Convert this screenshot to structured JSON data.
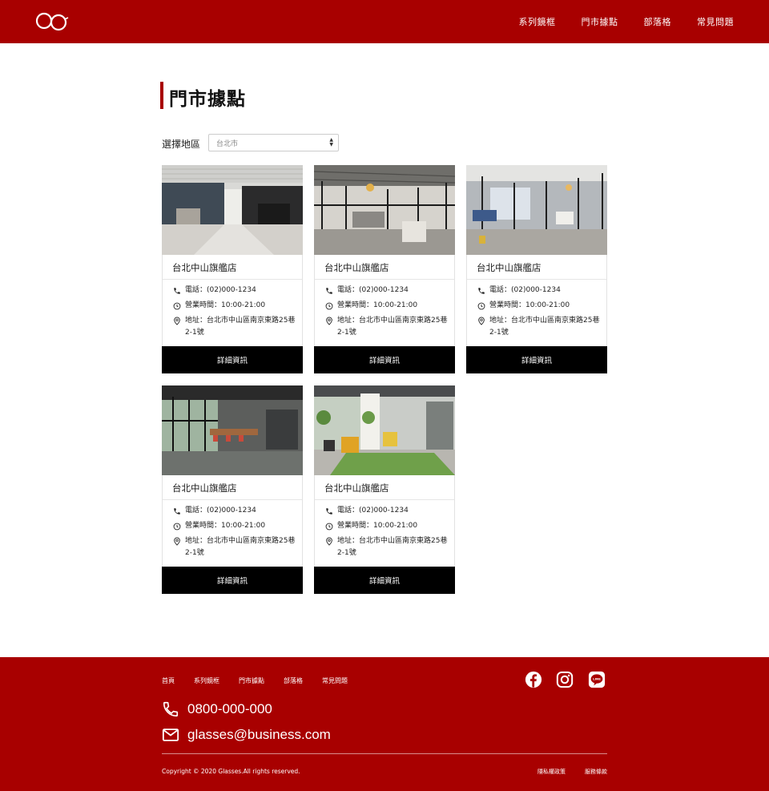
{
  "header": {
    "logo": "glasses-logo",
    "nav": [
      "系列鏡框",
      "門市據點",
      "部落格",
      "常見問題"
    ]
  },
  "page": {
    "title": "門市據點",
    "region_label": "選擇地區",
    "region_value": "台北市"
  },
  "stores": [
    {
      "name": "台北中山旗艦店",
      "phone": "電話：(02)000-1234",
      "hours": "營業時間：10:00-21:00",
      "address": "地址：台北市中山區南京東路25巷2-1號",
      "button": "詳細資訊"
    },
    {
      "name": "台北中山旗艦店",
      "phone": "電話：(02)000-1234",
      "hours": "營業時間：10:00-21:00",
      "address": "地址：台北市中山區南京東路25巷2-1號",
      "button": "詳細資訊"
    },
    {
      "name": "台北中山旗艦店",
      "phone": "電話：(02)000-1234",
      "hours": "營業時間：10:00-21:00",
      "address": "地址：台北市中山區南京東路25巷2-1號",
      "button": "詳細資訊"
    },
    {
      "name": "台北中山旗艦店",
      "phone": "電話：(02)000-1234",
      "hours": "營業時間：10:00-21:00",
      "address": "地址：台北市中山區南京東路25巷2-1號",
      "button": "詳細資訊"
    },
    {
      "name": "台北中山旗艦店",
      "phone": "電話：(02)000-1234",
      "hours": "營業時間：10:00-21:00",
      "address": "地址：台北市中山區南京東路25巷2-1號",
      "button": "詳細資訊"
    }
  ],
  "footer": {
    "nav": [
      "首頁",
      "系列鏡框",
      "門市據點",
      "部落格",
      "常見問題"
    ],
    "social": [
      "facebook-icon",
      "instagram-icon",
      "line-icon"
    ],
    "phone": "0800-000-000",
    "email": "glasses@business.com",
    "copyright": "Copyright © 2020 Glasses.All rights reserved.",
    "legal": [
      "隱私權政策",
      "服務條款"
    ]
  },
  "colors": {
    "brand": "#a80000",
    "button": "#000000"
  }
}
